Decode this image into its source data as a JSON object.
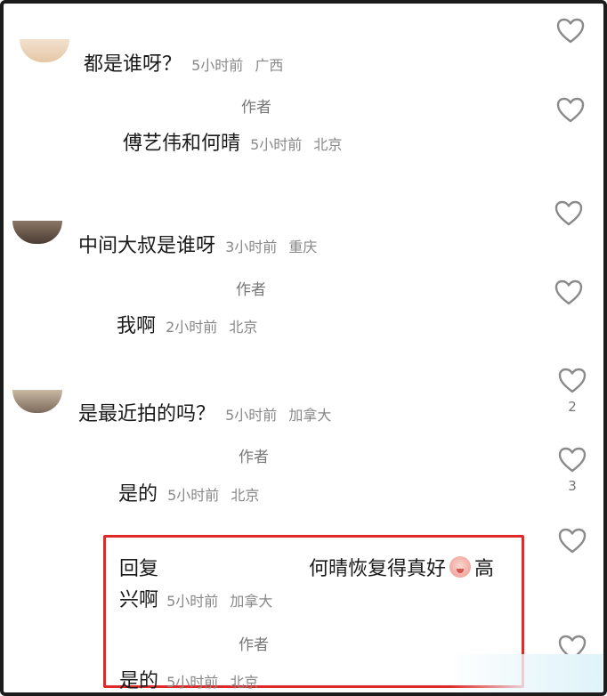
{
  "comments": [
    {
      "text": "都是谁呀？",
      "time": "5小时前",
      "location": "广西",
      "reply": {
        "author": "作者",
        "text": "傅艺伟和何晴",
        "time": "5小时前",
        "location": "北京"
      }
    },
    {
      "text": "中间大叔是谁呀",
      "time": "3小时前",
      "location": "重庆",
      "reply": {
        "author": "作者",
        "text": "我啊",
        "time": "2小时前",
        "location": "北京"
      }
    },
    {
      "text": "是最近拍的吗？",
      "time": "5小时前",
      "location": "加拿大",
      "likes": "2",
      "reply": {
        "author": "作者",
        "text": "是的",
        "time": "5小时前",
        "location": "北京",
        "likes": "3"
      }
    },
    {
      "reply_prefix": "回复",
      "text_part1": "何晴恢复得真好",
      "text_part2": "高",
      "text_part3": "兴啊",
      "emoji": "blushing-face-emoji",
      "time": "5小时前",
      "location": "加拿大",
      "reply": {
        "author": "作者",
        "text": "是的",
        "time": "5小时前",
        "location": "北京"
      }
    }
  ],
  "colors": {
    "highlight_border": "#e02a2a",
    "meta_text": "#888888"
  },
  "icons": [
    "heart-outline-icon"
  ]
}
